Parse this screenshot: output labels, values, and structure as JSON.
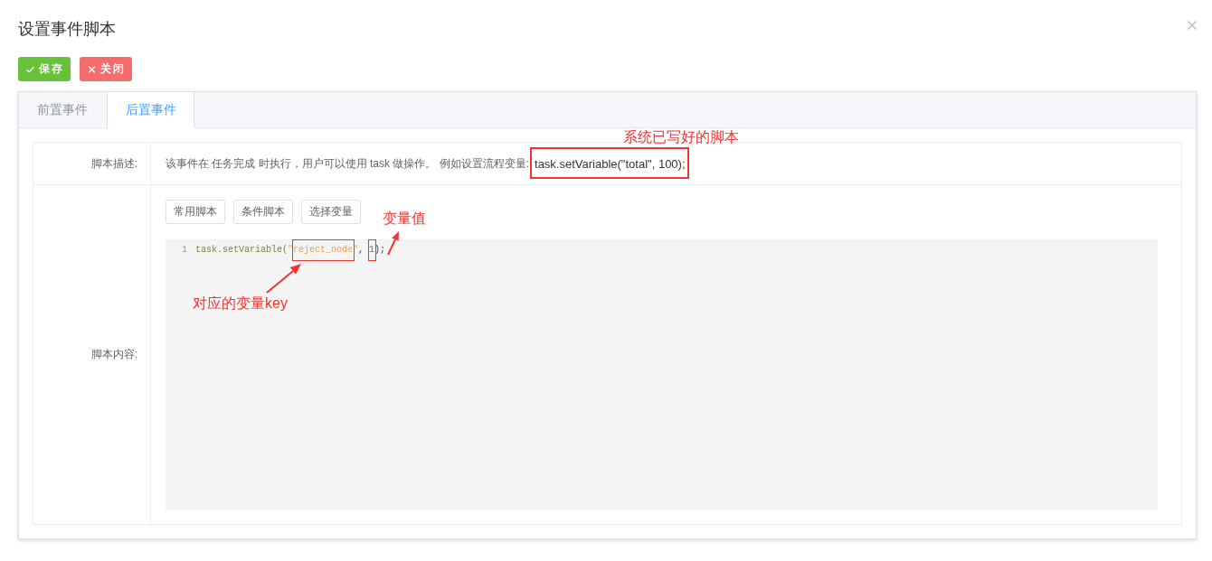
{
  "dialog": {
    "title": "设置事件脚本"
  },
  "toolbar": [
    {
      "kind": "save",
      "label": "保存"
    },
    {
      "kind": "close",
      "label": "关闭"
    }
  ],
  "tabs": [
    {
      "label": "前置事件",
      "selected": false
    },
    {
      "label": "后置事件",
      "selected": true
    }
  ],
  "form": {
    "description_label": "脚本描述:",
    "description": "该事件在 任务完成 时执行，用户可以使用 task 做操作。 例如设置流程变量:",
    "example": {
      "text": "task.setVariable(\"total\", 100);",
      "highlighted": true,
      "callout": "系统已写好的脚本"
    },
    "content_label": "脚本内容:",
    "script_buttons": [
      "常用脚本",
      "条件脚本",
      "选择变量"
    ],
    "code_lines": [
      {
        "number": "1",
        "tokens": [
          {
            "kind": "function",
            "text": "task.setVariable(",
            "highlighted": false
          },
          {
            "kind": "string",
            "text": "\"",
            "highlighted": false
          },
          {
            "kind": "string",
            "text": "reject_node",
            "highlighted": true,
            "callout": {
              "kind": "below",
              "text": "对应的变量key"
            }
          },
          {
            "kind": "string",
            "text": "\"",
            "highlighted": false
          },
          {
            "kind": "punctuation",
            "text": ", ",
            "highlighted": false
          },
          {
            "kind": "number",
            "text": "1",
            "highlighted": true,
            "callout": {
              "kind": "above",
              "text": "变量值"
            }
          },
          {
            "kind": "punctuation",
            "text": ");",
            "highlighted": false
          }
        ]
      }
    ]
  }
}
